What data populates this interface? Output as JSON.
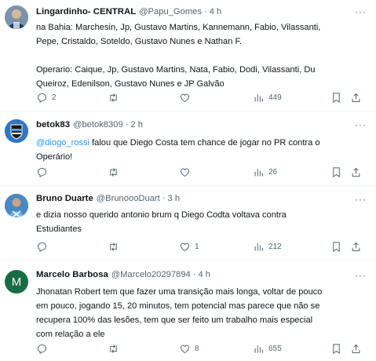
{
  "tweets": [
    {
      "name": "Lingardinho- CENTRAL",
      "handle": "@Papu_Gomes",
      "time": "4 h",
      "text": "na Bahia: Marchesin, Jp, Gustavo Martins, Kannemann, Fabio, Vilassanti,\nPepe, Cristaldo, Soteldo, Gustavo Nunes e Nathan F.\n\nOperario: Caique, Jp, Gustavo Martins, Nata, Fabio, Dodi, Vilassanti, Du\nQueiroz, Edenilson, Gustavo Nunes e JP Galvão",
      "replies": "2",
      "retweets": "",
      "likes": "",
      "views": "449"
    },
    {
      "name": "betok83",
      "handle": "@betok8309",
      "time": "2 h",
      "mention": "@diogo_rossi",
      "text": " falou que Diego Costa tem chance de jogar no PR contra o\nOperário!",
      "replies": "",
      "retweets": "",
      "likes": "",
      "views": "26"
    },
    {
      "name": "Bruno Duarte",
      "handle": "@BrunoooDuart",
      "time": "3 h",
      "text": "e dizia nosso querido antonio brum q Diego Codta voltava contra\nEstudiantes",
      "replies": "",
      "retweets": "",
      "likes": "1",
      "views": "212"
    },
    {
      "name": "Marcelo Barbosa",
      "handle": "@Marcelo20297894",
      "time": "4 h",
      "avatar_letter": "M",
      "text": "Jhonatan Robert tem que fazer uma transição mais longa, voltar de pouco\nem pouco, jogando 15, 20 minutos, tem potencial mas parece que não se\nrecupera 100% das lesões, tem que ser feito um trabalho mais especial\ncom relação a ele",
      "replies": "",
      "retweets": "",
      "likes": "8",
      "views": "655"
    }
  ],
  "separator": "·",
  "more_label": "···",
  "icons": {
    "reply": "reply-icon",
    "retweet": "retweet-icon",
    "like": "heart-icon",
    "views": "views-chart-icon",
    "bookmark": "bookmark-icon",
    "share": "share-icon"
  },
  "colors": {
    "text": "#0f1419",
    "secondary": "#536471",
    "link": "#1d9bf0",
    "divider": "#eff3f4",
    "marcelo_avatar": "#176c43"
  }
}
